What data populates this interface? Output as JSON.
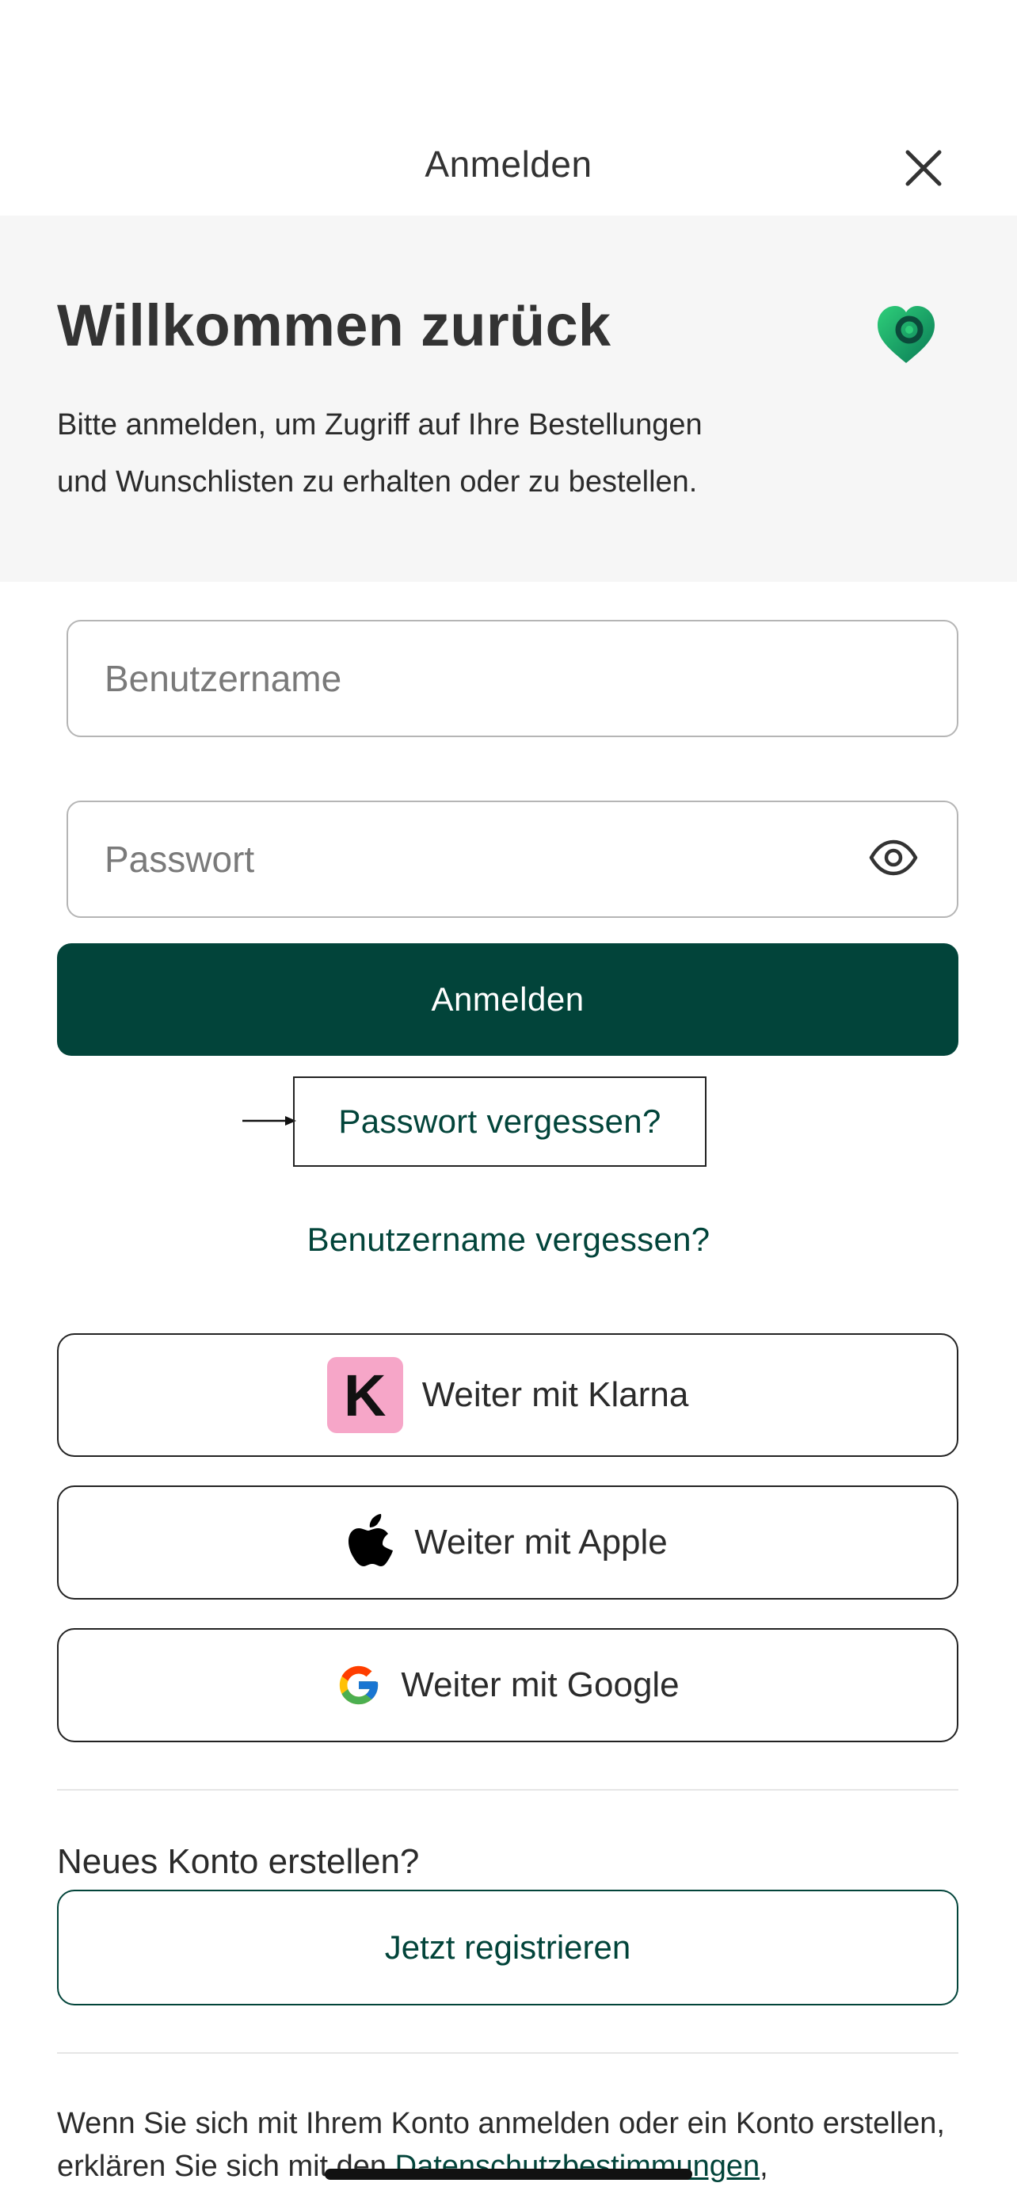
{
  "header": {
    "title": "Anmelden",
    "close_icon": "close-icon"
  },
  "welcome": {
    "title": "Willkommen zurück",
    "text_line1": "Bitte anmelden, um Zugriff auf Ihre Bestellungen",
    "text_line2": "und Wunschlisten zu erhalten oder zu bestellen.",
    "logo_icon": "heart-logo-icon"
  },
  "form": {
    "username_placeholder": "Benutzername",
    "username_value": "",
    "password_placeholder": "Passwort",
    "password_value": "",
    "login_label": "Anmelden"
  },
  "links": {
    "forgot_password": "Passwort vergessen?",
    "forgot_username": "Benutzername vergessen?"
  },
  "social": {
    "klarna_label": "Weiter mit Klarna",
    "klarna_logo_letter": "K",
    "apple_label": "Weiter mit Apple",
    "google_label": "Weiter mit Google"
  },
  "register": {
    "heading": "Neues Konto erstellen?",
    "button_label": "Jetzt registrieren"
  },
  "legal": {
    "text_before_link": "Wenn Sie sich mit Ihrem Konto anmelden oder ein Konto erstellen, erklären Sie sich mit den ",
    "link_label": "Datenschutzbestimmungen",
    "text_after_link": ","
  },
  "colors": {
    "primary": "#02443a",
    "panel_bg": "#f6f6f6",
    "klarna_pink": "#f6a6c8"
  }
}
